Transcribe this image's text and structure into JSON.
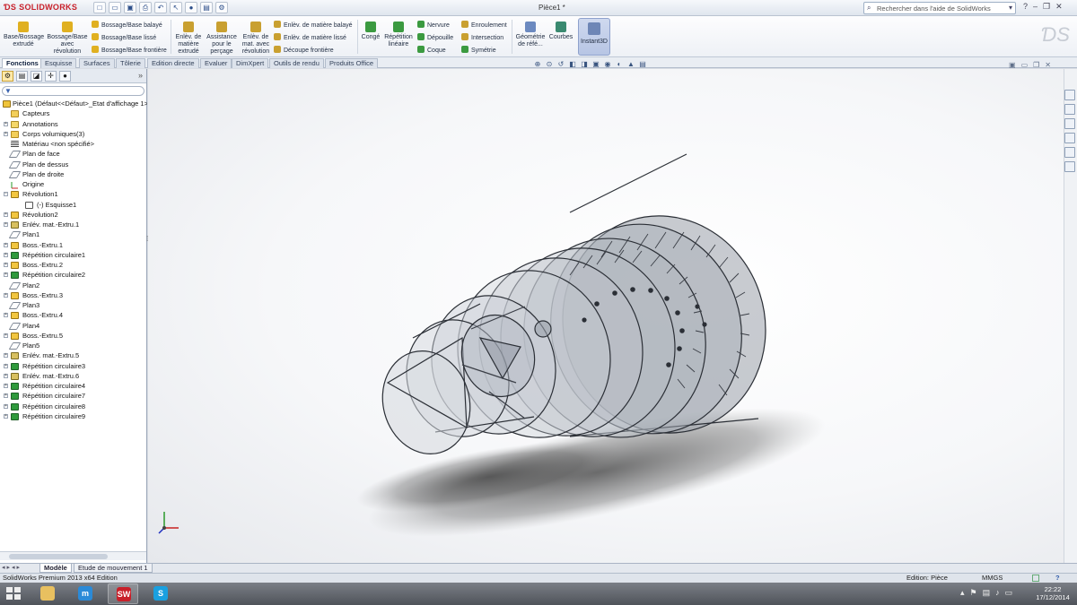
{
  "app": {
    "logo": "SOLIDWORKS",
    "document_title": "Pièce1 *",
    "help_search_placeholder": "Rechercher dans l'aide de SolidWorks"
  },
  "ribbon": {
    "buttons": [
      {
        "id": "extrude",
        "label": "Base/Bossage extrudé",
        "icon": "extrude-boss-icon",
        "color": "#e0b020"
      },
      {
        "id": "revolve",
        "label": "Bossage/Base avec révolution",
        "icon": "revolve-boss-icon",
        "color": "#e0b020"
      },
      {
        "id": "cut_extrude",
        "label": "Enlèv. de matière extrudé",
        "icon": "extrude-cut-icon",
        "color": "#c9a030"
      },
      {
        "id": "hole_wizard",
        "label": "Assistance pour le perçage",
        "icon": "hole-wizard-icon",
        "color": "#c9a030"
      },
      {
        "id": "cut_revolve",
        "label": "Enlèv. de mat. avec révolution",
        "icon": "revolve-cut-icon",
        "color": "#c9a030"
      },
      {
        "id": "fillet",
        "label": "Congé",
        "icon": "fillet-icon",
        "color": "#3b9a40"
      },
      {
        "id": "linear_pattern",
        "label": "Répétition linéaire",
        "icon": "linear-pattern-icon",
        "color": "#3b9a40"
      },
      {
        "id": "ref_geometry",
        "label": "Géométrie de réfé...",
        "icon": "reference-geometry-icon",
        "color": "#6c8ac0"
      },
      {
        "id": "curves",
        "label": "Courbes",
        "icon": "curves-icon",
        "color": "#3a8a70"
      },
      {
        "id": "instant3d",
        "label": "Instant3D",
        "icon": "instant3d-icon",
        "color": "#6e86b6"
      }
    ],
    "small_items": [
      {
        "id": "swept_boss",
        "label": "Bossage/Base balayé",
        "color": "#e0b020"
      },
      {
        "id": "loft_boss",
        "label": "Bossage/Base lissé",
        "color": "#e0b020"
      },
      {
        "id": "boundary_boss",
        "label": "Bossage/Base frontière",
        "color": "#e0b020"
      },
      {
        "id": "swept_cut",
        "label": "Enlèv. de matière balayé",
        "color": "#c9a030"
      },
      {
        "id": "loft_cut",
        "label": "Enlèv. de matière lissé",
        "color": "#c9a030"
      },
      {
        "id": "boundary_cut",
        "label": "Découpe frontière",
        "color": "#c9a030"
      },
      {
        "id": "rib",
        "label": "Nervure",
        "color": "#3b9a40"
      },
      {
        "id": "draft",
        "label": "Dépouille",
        "color": "#3b9a40"
      },
      {
        "id": "shell",
        "label": "Coque",
        "color": "#3b9a40"
      },
      {
        "id": "wrap",
        "label": "Enroulement",
        "color": "#c9a030"
      },
      {
        "id": "intersect",
        "label": "Intersection",
        "color": "#c9a030"
      },
      {
        "id": "mirror",
        "label": "Symétrie",
        "color": "#3b9a40"
      }
    ]
  },
  "tabs": [
    "Fonctions",
    "Esquisse",
    "Surfaces",
    "Tôlerie",
    "Edition directe",
    "Evaluer",
    "DimXpert",
    "Outils de rendu",
    "Produits Office"
  ],
  "active_tab": "Fonctions",
  "feature_tree": {
    "root": "Pièce1 (Défaut<<Défaut>_Etat d'affichage 1>)",
    "nodes": [
      {
        "label": "Capteurs",
        "icon": "folder",
        "level": 1,
        "expander": ""
      },
      {
        "label": "Annotations",
        "icon": "note",
        "level": 1,
        "expander": "+"
      },
      {
        "label": "Corps volumiques(3)",
        "icon": "folder",
        "level": 1,
        "expander": "+"
      },
      {
        "label": "Matériau <non spécifié>",
        "icon": "mat",
        "level": 1,
        "expander": ""
      },
      {
        "label": "Plan de face",
        "icon": "plane",
        "level": 1,
        "expander": ""
      },
      {
        "label": "Plan de dessus",
        "icon": "plane",
        "level": 1,
        "expander": ""
      },
      {
        "label": "Plan de droite",
        "icon": "plane",
        "level": 1,
        "expander": ""
      },
      {
        "label": "Origine",
        "icon": "origin",
        "level": 1,
        "expander": ""
      },
      {
        "label": "Révolution1",
        "icon": "feat",
        "level": 1,
        "expander": "-"
      },
      {
        "label": "(-) Esquisse1",
        "icon": "sketch",
        "level": 2,
        "expander": ""
      },
      {
        "label": "Révolution2",
        "icon": "feat",
        "level": 1,
        "expander": "+"
      },
      {
        "label": "Enlév. mat.-Extru.1",
        "icon": "cut",
        "level": 1,
        "expander": "+"
      },
      {
        "label": "Plan1",
        "icon": "plane",
        "level": 1,
        "expander": ""
      },
      {
        "label": "Boss.-Extru.1",
        "icon": "feat",
        "level": 1,
        "expander": "+"
      },
      {
        "label": "Répétition circulaire1",
        "icon": "pattern",
        "level": 1,
        "expander": "+"
      },
      {
        "label": "Boss.-Extru.2",
        "icon": "feat",
        "level": 1,
        "expander": "+"
      },
      {
        "label": "Répétition circulaire2",
        "icon": "pattern",
        "level": 1,
        "expander": "+"
      },
      {
        "label": "Plan2",
        "icon": "plane",
        "level": 1,
        "expander": ""
      },
      {
        "label": "Boss.-Extru.3",
        "icon": "feat",
        "level": 1,
        "expander": "+"
      },
      {
        "label": "Plan3",
        "icon": "plane",
        "level": 1,
        "expander": ""
      },
      {
        "label": "Boss.-Extru.4",
        "icon": "feat",
        "level": 1,
        "expander": "+"
      },
      {
        "label": "Plan4",
        "icon": "plane",
        "level": 1,
        "expander": ""
      },
      {
        "label": "Boss.-Extru.5",
        "icon": "feat",
        "level": 1,
        "expander": "+"
      },
      {
        "label": "Plan5",
        "icon": "plane",
        "level": 1,
        "expander": ""
      },
      {
        "label": "Enlév. mat.-Extru.5",
        "icon": "cut",
        "level": 1,
        "expander": "+"
      },
      {
        "label": "Répétition circulaire3",
        "icon": "pattern",
        "level": 1,
        "expander": "+"
      },
      {
        "label": "Enlév. mat.-Extru.6",
        "icon": "cut",
        "level": 1,
        "expander": "+"
      },
      {
        "label": "Répétition circulaire4",
        "icon": "pattern",
        "level": 1,
        "expander": "+"
      },
      {
        "label": "Répétition circulaire7",
        "icon": "pattern",
        "level": 1,
        "expander": "+"
      },
      {
        "label": "Répétition circulaire8",
        "icon": "pattern",
        "level": 1,
        "expander": "+"
      },
      {
        "label": "Répétition circulaire9",
        "icon": "pattern",
        "level": 1,
        "expander": "+"
      }
    ]
  },
  "bottom_tabs": [
    "Modèle",
    "Etude de mouvement 1"
  ],
  "status": {
    "edition": "SolidWorks Premium 2013 x64 Edition",
    "mode": "Edition: Pièce",
    "units": "MMGS",
    "help": "?"
  },
  "taskbar": {
    "apps": [
      {
        "name": "explorer",
        "icon": "folder-icon",
        "color": "#e8c060",
        "glyph": ""
      },
      {
        "name": "maxthon",
        "icon": "maxthon-icon",
        "color": "#2a8ad8",
        "glyph": "m"
      },
      {
        "name": "solidworks",
        "icon": "solidworks-icon",
        "color": "#c8202a",
        "glyph": "SW"
      },
      {
        "name": "skype",
        "icon": "skype-icon",
        "color": "#1aa0e0",
        "glyph": "S"
      }
    ],
    "time": "22:22",
    "date": "17/12/2014"
  }
}
